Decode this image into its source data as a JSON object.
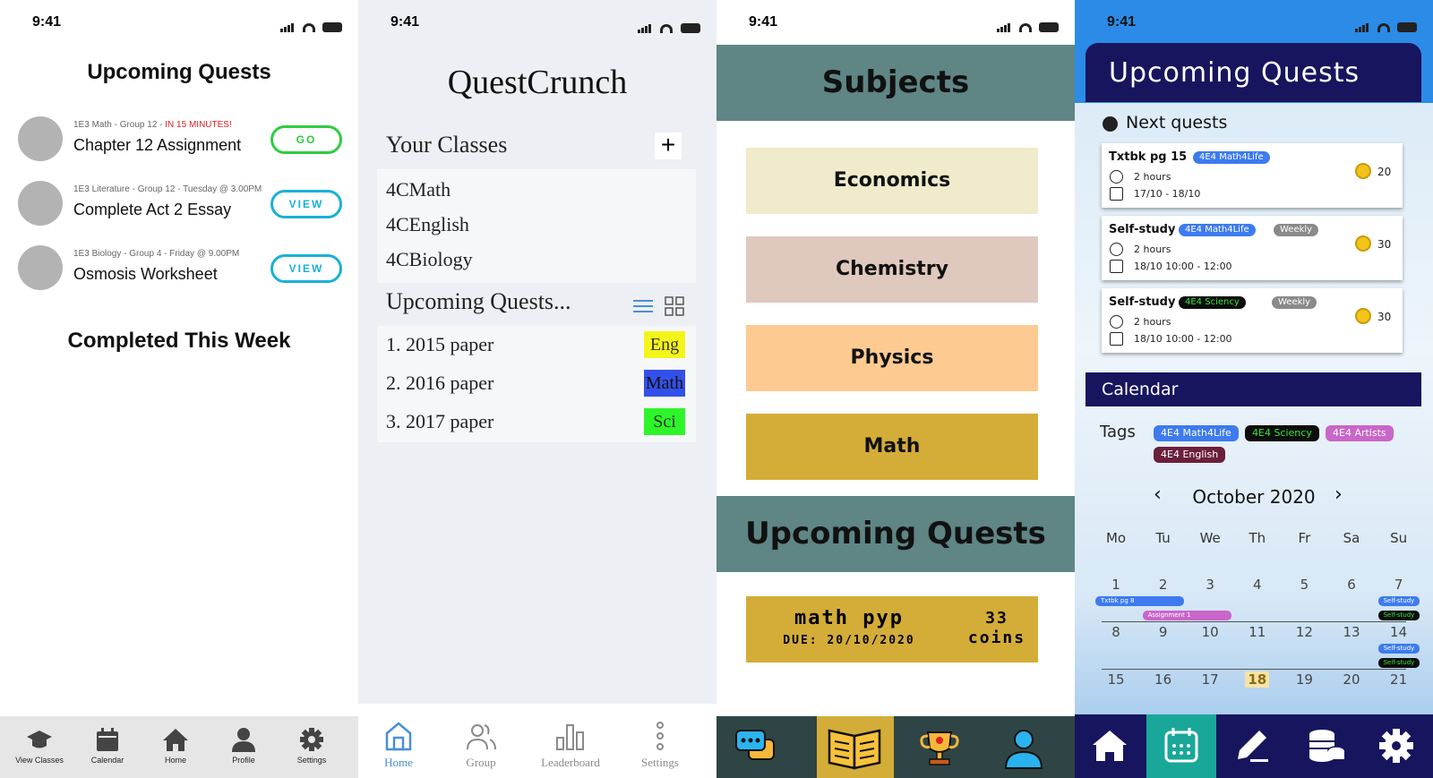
{
  "status": {
    "time": "9:41"
  },
  "screen1": {
    "title": "Upcoming Quests",
    "quests": [
      {
        "meta": "1E3 Math - Group 12 - ",
        "warn": "IN 15 MINUTES!",
        "title": "Chapter 12 Assignment",
        "button": "GO",
        "color": "#2ecc40"
      },
      {
        "meta": "1E3 Literature - Group 12 - Tuesday @ 3.00PM",
        "warn": "",
        "title": "Complete Act 2 Essay",
        "button": "VIEW",
        "color": "#1ab0d9"
      },
      {
        "meta": "1E3 Biology - Group 4 - Friday @ 9.00PM",
        "warn": "",
        "title": "Osmosis Worksheet",
        "button": "VIEW",
        "color": "#1ab0d9"
      }
    ],
    "completed_title": "Completed This Week",
    "nav": [
      {
        "label": "View Classes",
        "icon": "graduation-cap-icon"
      },
      {
        "label": "Calendar",
        "icon": "calendar-icon"
      },
      {
        "label": "Home",
        "icon": "home-icon"
      },
      {
        "label": "Profile",
        "icon": "user-icon"
      },
      {
        "label": "Settings",
        "icon": "gear-icon"
      }
    ]
  },
  "screen2": {
    "brand": "QuestCrunch",
    "classes_title": "Your Classes",
    "add_symbol": "+",
    "classes": [
      "4CMath",
      "4CEnglish",
      "4CBiology"
    ],
    "quests_title": "Upcoming Quests...",
    "quests": [
      {
        "label": "1. 2015 paper",
        "tag": "Eng",
        "tag_bg": "#f3f51a",
        "tag_fg": "#333333"
      },
      {
        "label": "2. 2016 paper",
        "tag": "Math",
        "tag_bg": "#3350ea",
        "tag_fg": "#111111"
      },
      {
        "label": "3. 2017 paper",
        "tag": "Sci",
        "tag_bg": "#2ef52a",
        "tag_fg": "#333333"
      }
    ],
    "nav": [
      {
        "label": "Home",
        "active": true
      },
      {
        "label": "Group",
        "active": false
      },
      {
        "label": "Leaderboard",
        "active": false
      },
      {
        "label": "Settings",
        "active": false
      }
    ],
    "active_color": "#4a8fd6"
  },
  "screen3": {
    "subjects_title": "Subjects",
    "subjects": [
      {
        "label": "Economics",
        "color": "#f0ebca"
      },
      {
        "label": "Chemistry",
        "color": "#dfc8bd"
      },
      {
        "label": "Physics",
        "color": "#fdcb91"
      },
      {
        "label": "Math",
        "color": "#d3ad38"
      }
    ],
    "quests_title": "Upcoming Quests",
    "quest": {
      "title": "math pyp",
      "due": "DUE: 20/10/2020",
      "amount": "33",
      "unit": "coins"
    },
    "nav": [
      "chat-icon",
      "book-icon",
      "trophy-icon",
      "user-icon"
    ]
  },
  "screen4": {
    "title": "Upcoming Quests",
    "next_title": "Next quests",
    "cards": [
      {
        "title": "Txtbk pg 15",
        "tags": [
          {
            "label": "4E4 Math4Life",
            "bg": "#3d7bef",
            "fg": "#ffffff"
          }
        ],
        "duration": "2 hours",
        "date": "17/10 - 18/10",
        "coins": "20"
      },
      {
        "title": "Self-study",
        "tags": [
          {
            "label": "4E4 Math4Life",
            "bg": "#3d7bef",
            "fg": "#ffffff"
          },
          {
            "label": "Weekly",
            "bg": "#8a8a8a",
            "fg": "#ffffff"
          }
        ],
        "duration": "2 hours",
        "date": "18/10 10:00 - 12:00",
        "coins": "30"
      },
      {
        "title": "Self-study",
        "tags": [
          {
            "label": "4E4 Sciency",
            "bg": "#0d0d0d",
            "fg": "#35e535"
          },
          {
            "label": "Weekly",
            "bg": "#8a8a8a",
            "fg": "#ffffff"
          }
        ],
        "duration": "2 hours",
        "date": "18/10 10:00 - 12:00",
        "coins": "30"
      }
    ],
    "calendar_title": "Calendar",
    "tags_label": "Tags",
    "tags": [
      {
        "label": "4E4 Math4Life",
        "bg": "#3d7bef",
        "fg": "#ffffff"
      },
      {
        "label": "4E4 Sciency",
        "bg": "#0d0d0d",
        "fg": "#35e535"
      },
      {
        "label": "4E4 Artists",
        "bg": "#c966c9",
        "fg": "#ffffff"
      },
      {
        "label": "4E4 English",
        "bg": "#6b1f3b",
        "fg": "#ffffff"
      }
    ],
    "month": "October 2020",
    "prev": "‹",
    "next": "›",
    "weekdays": [
      "Mo",
      "Tu",
      "We",
      "Th",
      "Fr",
      "Sa",
      "Su"
    ],
    "weeks": [
      [
        "1",
        "2",
        "3",
        "4",
        "5",
        "6",
        "7"
      ],
      [
        "8",
        "9",
        "10",
        "11",
        "12",
        "13",
        "14"
      ],
      [
        "15",
        "16",
        "17",
        "18",
        "19",
        "20",
        "21"
      ]
    ],
    "today": "18",
    "events": [
      {
        "label": "Txtbk pg 8",
        "week": 0,
        "start": 0,
        "span": 2,
        "row": 0,
        "bg": "#3d7bef"
      },
      {
        "label": "Assignment 1",
        "week": 0,
        "start": 1,
        "span": 2,
        "row": 1,
        "bg": "#c966c9"
      },
      {
        "label": "Self-study",
        "week": 0,
        "start": 6,
        "span": 1,
        "row": 0,
        "bg": "#3d7bef"
      },
      {
        "label": "Self-study",
        "week": 0,
        "start": 6,
        "span": 1,
        "row": 1,
        "bg": "#0d0d0d"
      },
      {
        "label": "Self-study",
        "week": 1,
        "start": 6,
        "span": 1,
        "row": 0,
        "bg": "#3d7bef"
      },
      {
        "label": "Self-study",
        "week": 1,
        "start": 6,
        "span": 1,
        "row": 1,
        "bg": "#0d0d0d"
      }
    ],
    "nav": [
      "home-icon",
      "calendar-icon",
      "pencil-icon",
      "coins-icon",
      "gear-icon"
    ]
  }
}
